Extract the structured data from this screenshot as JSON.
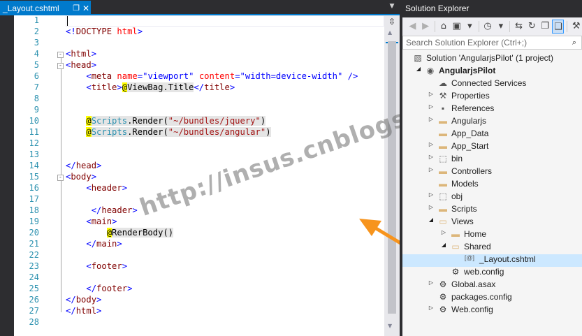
{
  "editor": {
    "tab": {
      "title": "_Layout.cshtml",
      "pin_glyph": "❐",
      "close_glyph": "✕"
    },
    "line_numbers": [
      "1",
      "2",
      "3",
      "4",
      "5",
      "6",
      "7",
      "8",
      "9",
      "10",
      "11",
      "12",
      "13",
      "14",
      "15",
      "16",
      "17",
      "18",
      "19",
      "20",
      "21",
      "22",
      "23",
      "24",
      "25",
      "26",
      "27",
      "28"
    ],
    "code_lines": [
      [],
      [
        {
          "t": "pun",
          "v": "<!"
        },
        {
          "t": "tag",
          "v": "DOCTYPE"
        },
        {
          "t": "txt",
          "v": " "
        },
        {
          "t": "attr",
          "v": "html"
        },
        {
          "t": "pun",
          "v": ">"
        }
      ],
      [],
      [
        {
          "t": "pun",
          "v": "<"
        },
        {
          "t": "tag",
          "v": "html"
        },
        {
          "t": "pun",
          "v": ">"
        }
      ],
      [
        {
          "t": "pun",
          "v": "<"
        },
        {
          "t": "tag",
          "v": "head"
        },
        {
          "t": "pun",
          "v": ">"
        }
      ],
      [
        {
          "t": "txt",
          "v": "    "
        },
        {
          "t": "pun",
          "v": "<"
        },
        {
          "t": "tag",
          "v": "meta"
        },
        {
          "t": "txt",
          "v": " "
        },
        {
          "t": "attr",
          "v": "name"
        },
        {
          "t": "pun",
          "v": "="
        },
        {
          "t": "aval",
          "v": "\"viewport\""
        },
        {
          "t": "txt",
          "v": " "
        },
        {
          "t": "attr",
          "v": "content"
        },
        {
          "t": "pun",
          "v": "="
        },
        {
          "t": "aval",
          "v": "\"width=device-width\""
        },
        {
          "t": "txt",
          "v": " "
        },
        {
          "t": "pun",
          "v": "/>"
        }
      ],
      [
        {
          "t": "txt",
          "v": "    "
        },
        {
          "t": "pun",
          "v": "<"
        },
        {
          "t": "tag",
          "v": "title"
        },
        {
          "t": "pun",
          "v": ">"
        },
        {
          "t": "razor",
          "v": "@"
        },
        {
          "t": "hltxt",
          "v": "ViewBag.Title"
        },
        {
          "t": "pun",
          "v": "</"
        },
        {
          "t": "tag",
          "v": "title"
        },
        {
          "t": "pun",
          "v": ">"
        }
      ],
      [],
      [],
      [
        {
          "t": "txt",
          "v": "    "
        },
        {
          "t": "razor",
          "v": "@"
        },
        {
          "t": "hlrid",
          "v": "Scripts"
        },
        {
          "t": "hltxt",
          "v": ".Render("
        },
        {
          "t": "hlstr",
          "v": "\"~/bundles/jquery\""
        },
        {
          "t": "hltxt",
          "v": ")"
        }
      ],
      [
        {
          "t": "txt",
          "v": "    "
        },
        {
          "t": "razor",
          "v": "@"
        },
        {
          "t": "hlrid",
          "v": "Scripts"
        },
        {
          "t": "hltxt",
          "v": ".Render("
        },
        {
          "t": "hlstr",
          "v": "\"~/bundles/angular\""
        },
        {
          "t": "hltxt",
          "v": ")"
        }
      ],
      [],
      [],
      [
        {
          "t": "pun",
          "v": "</"
        },
        {
          "t": "tag",
          "v": "head"
        },
        {
          "t": "pun",
          "v": ">"
        }
      ],
      [
        {
          "t": "pun",
          "v": "<"
        },
        {
          "t": "tag",
          "v": "body"
        },
        {
          "t": "pun",
          "v": ">"
        }
      ],
      [
        {
          "t": "txt",
          "v": "    "
        },
        {
          "t": "pun",
          "v": "<"
        },
        {
          "t": "tag",
          "v": "header"
        },
        {
          "t": "pun",
          "v": ">"
        }
      ],
      [],
      [
        {
          "t": "txt",
          "v": "     "
        },
        {
          "t": "pun",
          "v": "</"
        },
        {
          "t": "tag",
          "v": "header"
        },
        {
          "t": "pun",
          "v": ">"
        }
      ],
      [
        {
          "t": "txt",
          "v": "    "
        },
        {
          "t": "pun",
          "v": "<"
        },
        {
          "t": "tag",
          "v": "main"
        },
        {
          "t": "pun",
          "v": ">"
        }
      ],
      [
        {
          "t": "txt",
          "v": "        "
        },
        {
          "t": "razor",
          "v": "@"
        },
        {
          "t": "hltxt",
          "v": "RenderBody()"
        }
      ],
      [
        {
          "t": "txt",
          "v": "    "
        },
        {
          "t": "pun",
          "v": "</"
        },
        {
          "t": "tag",
          "v": "main"
        },
        {
          "t": "pun",
          "v": ">"
        }
      ],
      [],
      [
        {
          "t": "txt",
          "v": "    "
        },
        {
          "t": "pun",
          "v": "<"
        },
        {
          "t": "tag",
          "v": "footer"
        },
        {
          "t": "pun",
          "v": ">"
        }
      ],
      [],
      [
        {
          "t": "txt",
          "v": "    "
        },
        {
          "t": "pun",
          "v": "</"
        },
        {
          "t": "tag",
          "v": "footer"
        },
        {
          "t": "pun",
          "v": ">"
        }
      ],
      [
        {
          "t": "pun",
          "v": "</"
        },
        {
          "t": "tag",
          "v": "body"
        },
        {
          "t": "pun",
          "v": ">"
        }
      ],
      [
        {
          "t": "pun",
          "v": "</"
        },
        {
          "t": "tag",
          "v": "html"
        },
        {
          "t": "pun",
          "v": ">"
        }
      ],
      []
    ],
    "fold_markers": [
      "-",
      "-",
      "-"
    ]
  },
  "watermark": "http://insus.cnblogs.com",
  "solution_explorer": {
    "title": "Solution Explorer",
    "search_placeholder": "Search Solution Explorer (Ctrl+;)",
    "search_icon": "search-icon",
    "toolbar_icons": [
      {
        "name": "back-icon",
        "glyph": "◀",
        "enabled": false
      },
      {
        "name": "forward-icon",
        "glyph": "▶",
        "enabled": false
      },
      {
        "name": "home-icon",
        "glyph": "⌂",
        "enabled": true
      },
      {
        "name": "switch-views-icon",
        "glyph": "▣",
        "enabled": true
      },
      {
        "name": "dropdown-icon",
        "glyph": "▾",
        "enabled": true
      },
      {
        "name": "pending-changes-icon",
        "glyph": "◷",
        "enabled": true
      },
      {
        "name": "dropdown-icon",
        "glyph": "▾",
        "enabled": true
      },
      {
        "name": "sync-icon",
        "glyph": "⇆",
        "enabled": true
      },
      {
        "name": "refresh-icon",
        "glyph": "↻",
        "enabled": true
      },
      {
        "name": "collapse-all-icon",
        "glyph": "❐",
        "enabled": true
      },
      {
        "name": "show-all-files-icon",
        "glyph": "❑",
        "enabled": true,
        "selected": true
      },
      {
        "name": "properties-icon",
        "glyph": "⚒",
        "enabled": true
      }
    ],
    "tree": [
      {
        "label": "Solution 'AngularjsPilot' (1 project)",
        "indent": 0,
        "expander": "",
        "icon": "solution-icon",
        "glyph": "▧"
      },
      {
        "label": "AngularjsPilot",
        "indent": 1,
        "expander": "◢",
        "icon": "web-project-icon",
        "glyph": "◉",
        "bold": true
      },
      {
        "label": "Connected Services",
        "indent": 2,
        "expander": "",
        "icon": "connected-services-icon",
        "glyph": "☁"
      },
      {
        "label": "Properties",
        "indent": 2,
        "expander": "▷",
        "icon": "wrench-icon",
        "glyph": "⚒"
      },
      {
        "label": "References",
        "indent": 2,
        "expander": "▷",
        "icon": "references-icon",
        "glyph": "▪"
      },
      {
        "label": "Angularjs",
        "indent": 2,
        "expander": "▷",
        "icon": "folder-icon",
        "glyph": "▬"
      },
      {
        "label": "App_Data",
        "indent": 2,
        "expander": "",
        "icon": "folder-icon",
        "glyph": "▬"
      },
      {
        "label": "App_Start",
        "indent": 2,
        "expander": "▷",
        "icon": "folder-icon",
        "glyph": "▬"
      },
      {
        "label": "bin",
        "indent": 2,
        "expander": "▷",
        "icon": "dashed-folder-icon",
        "glyph": "⬚"
      },
      {
        "label": "Controllers",
        "indent": 2,
        "expander": "▷",
        "icon": "folder-icon",
        "glyph": "▬"
      },
      {
        "label": "Models",
        "indent": 2,
        "expander": "",
        "icon": "folder-icon",
        "glyph": "▬"
      },
      {
        "label": "obj",
        "indent": 2,
        "expander": "▷",
        "icon": "dashed-folder-icon",
        "glyph": "⬚"
      },
      {
        "label": "Scripts",
        "indent": 2,
        "expander": "▷",
        "icon": "folder-icon",
        "glyph": "▬"
      },
      {
        "label": "Views",
        "indent": 2,
        "expander": "◢",
        "icon": "open-folder-icon",
        "glyph": "▭"
      },
      {
        "label": "Home",
        "indent": 3,
        "expander": "▷",
        "icon": "folder-icon",
        "glyph": "▬"
      },
      {
        "label": "Shared",
        "indent": 3,
        "expander": "◢",
        "icon": "open-folder-icon",
        "glyph": "▭"
      },
      {
        "label": "_Layout.cshtml",
        "indent": 4,
        "expander": "",
        "icon": "razor-file-icon",
        "glyph": "[@]",
        "selected": true
      },
      {
        "label": "web.config",
        "indent": 3,
        "expander": "",
        "icon": "config-file-icon",
        "glyph": "⚙"
      },
      {
        "label": "Global.asax",
        "indent": 2,
        "expander": "▷",
        "icon": "global-asax-icon",
        "glyph": "⚙"
      },
      {
        "label": "packages.config",
        "indent": 2,
        "expander": "",
        "icon": "config-file-icon",
        "glyph": "⚙"
      },
      {
        "label": "Web.config",
        "indent": 2,
        "expander": "▷",
        "icon": "config-file-icon",
        "glyph": "⚙"
      }
    ]
  },
  "colors": {
    "accent": "#007acc",
    "arrow": "#f7941d",
    "selection": "#cce8ff"
  }
}
